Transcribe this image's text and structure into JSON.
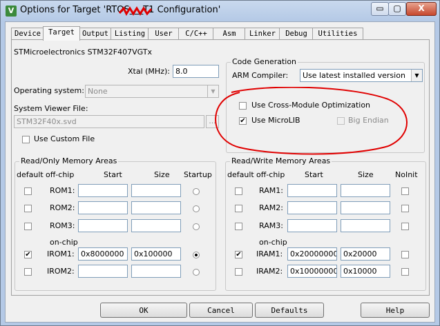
{
  "window": {
    "icon_letter": "V",
    "title": "Options for Target 'RTOS___T1 Configuration'",
    "minimize": "▭",
    "maximize": "▢",
    "close": "X"
  },
  "tabs": [
    "Device",
    "Target",
    "Output",
    "Listing",
    "User",
    "C/C++",
    "Asm",
    "Linker",
    "Debug",
    "Utilities"
  ],
  "device_name": "STMicroelectronics STM32F407VGTx",
  "xtal": {
    "label": "Xtal (MHz):",
    "value": "8.0"
  },
  "os": {
    "label": "Operating system:",
    "value": "None"
  },
  "svd": {
    "label": "System Viewer File:",
    "value": "STM32F40x.svd",
    "browse": "..."
  },
  "custom_file": {
    "label": "Use Custom File"
  },
  "codegen": {
    "title": "Code Generation",
    "compiler_label": "ARM Compiler:",
    "compiler_value": "Use latest installed version",
    "cross_module": "Use Cross-Module Optimization",
    "microlib": "Use MicroLIB",
    "big_endian": "Big Endian"
  },
  "ro": {
    "title": "Read/Only Memory Areas",
    "headers": {
      "default": "default",
      "offchip": "off-chip",
      "start": "Start",
      "size": "Size",
      "last": "Startup"
    },
    "onchip": "on-chip",
    "rows": [
      {
        "name": "ROM1:",
        "start": "",
        "size": ""
      },
      {
        "name": "ROM2:",
        "start": "",
        "size": ""
      },
      {
        "name": "ROM3:",
        "start": "",
        "size": ""
      },
      {
        "name": "IROM1:",
        "start": "0x8000000",
        "size": "0x100000"
      },
      {
        "name": "IROM2:",
        "start": "",
        "size": ""
      }
    ]
  },
  "rw": {
    "title": "Read/Write Memory Areas",
    "headers": {
      "default": "default",
      "offchip": "off-chip",
      "start": "Start",
      "size": "Size",
      "last": "NoInit"
    },
    "onchip": "on-chip",
    "rows": [
      {
        "name": "RAM1:",
        "start": "",
        "size": ""
      },
      {
        "name": "RAM2:",
        "start": "",
        "size": ""
      },
      {
        "name": "RAM3:",
        "start": "",
        "size": ""
      },
      {
        "name": "IRAM1:",
        "start": "0x20000000",
        "size": "0x20000"
      },
      {
        "name": "IRAM2:",
        "start": "0x10000000",
        "size": "0x10000"
      }
    ]
  },
  "buttons": {
    "ok": "OK",
    "cancel": "Cancel",
    "defaults": "Defaults",
    "help": "Help"
  },
  "check_mark": "✔"
}
